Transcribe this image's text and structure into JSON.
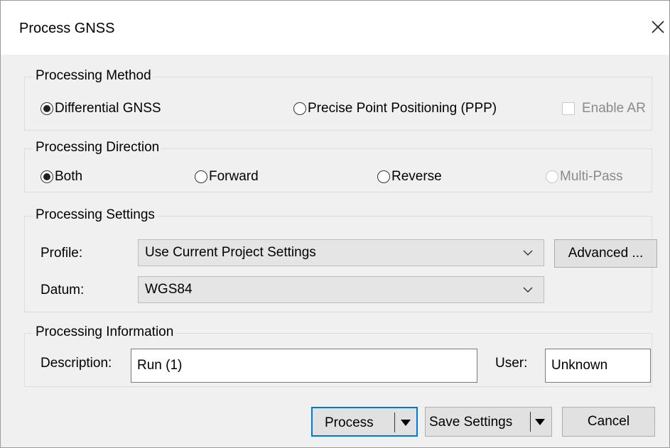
{
  "window": {
    "title": "Process GNSS"
  },
  "processing_method": {
    "legend": "Processing Method",
    "differential": {
      "label": "Differential GNSS",
      "checked": true
    },
    "ppp": {
      "label": "Precise Point Positioning (PPP)",
      "checked": false
    },
    "enable_ar": {
      "label": "Enable AR",
      "checked": false,
      "enabled": false
    }
  },
  "processing_direction": {
    "legend": "Processing Direction",
    "both": {
      "label": "Both",
      "checked": true
    },
    "forward": {
      "label": "Forward",
      "checked": false
    },
    "reverse": {
      "label": "Reverse",
      "checked": false
    },
    "multipass": {
      "label": "Multi-Pass",
      "checked": false,
      "enabled": false
    }
  },
  "processing_settings": {
    "legend": "Processing Settings",
    "profile_label": "Profile:",
    "profile_value": "Use Current Project Settings",
    "advanced_label": "Advanced ...",
    "datum_label": "Datum:",
    "datum_value": "WGS84"
  },
  "processing_information": {
    "legend": "Processing Information",
    "description_label": "Description:",
    "description_value": "Run (1)",
    "user_label": "User:",
    "user_value": "Unknown"
  },
  "buttons": {
    "process": "Process",
    "save_settings": "Save Settings",
    "cancel": "Cancel"
  },
  "icons": {
    "close": "close-icon",
    "dropdown": "chevron-down-icon",
    "split_arrow": "caret-down-icon"
  },
  "colors": {
    "default_button_border": "#0078d7",
    "dialog_background": "#f0f0f0"
  }
}
